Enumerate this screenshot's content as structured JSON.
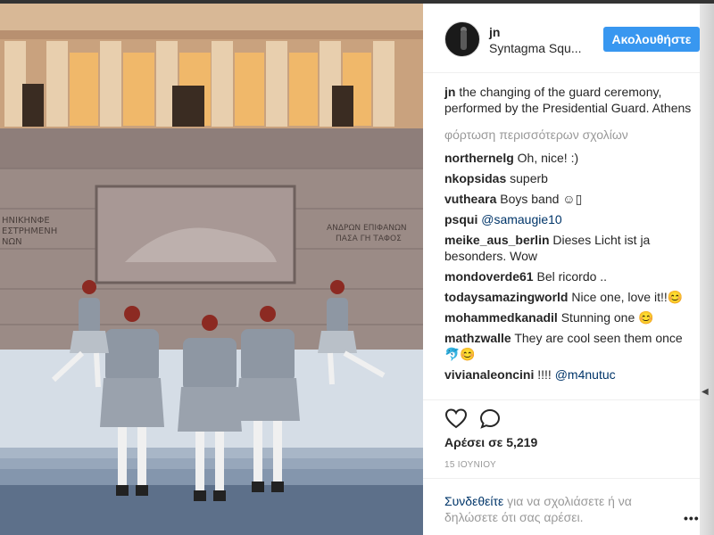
{
  "post": {
    "username": "jn",
    "location": "Syntagma Squ...",
    "follow_label": "Ακολουθήστε",
    "caption_user": "jn",
    "caption_text": "the changing of the guard ceremony, performed by the Presidential Guard. Athens",
    "load_more": "φόρτωση περισσότερων σχολίων",
    "comments": [
      {
        "user": "northernelg",
        "text": "Oh, nice! :)"
      },
      {
        "user": "nkopsidas",
        "text": "superb"
      },
      {
        "user": "vutheara",
        "text": "Boys band ☺▯"
      },
      {
        "user": "psqui",
        "text": "@samaugie10"
      },
      {
        "user": "meike_aus_berlin",
        "text": "Dieses Licht ist ja besonders. Wow"
      },
      {
        "user": "mondoverde61",
        "text": "Bel ricordo .."
      },
      {
        "user": "todaysamazingworld",
        "text": "Nice one, love it!!😊"
      },
      {
        "user": "mohammedkanadil",
        "text": "Stunning one 😊"
      },
      {
        "user": "mathzwalle",
        "text": "They are cool seen them once 🐬😊"
      },
      {
        "user": "vivianaleoncini",
        "text": "!!!! @m4nutuc"
      }
    ],
    "likes": "Αρέσει σε 5,219",
    "date": "15 ΙΟΥΝΙΟΥ",
    "login_link": "Συνδεθείτε",
    "login_rest": " για να σχολιάσετε ή να δηλώσετε ότι σας αρέσει.",
    "more_icon": "•••",
    "photo_inscriptions": {
      "left": "ΗΝΙΚΗΝΦΕ ΕΣΤΡΗΜΕΝΗ ΝΩΝ",
      "right": "ΑΝΔΡΩΝ ΕΠΙΦΑΝΩΝ ΠΑΣΑ ΓΗ ΤΑΦΟΣ"
    }
  },
  "colors": {
    "accent": "#3897f0",
    "link": "#003569",
    "muted": "#999999",
    "text": "#262626"
  }
}
